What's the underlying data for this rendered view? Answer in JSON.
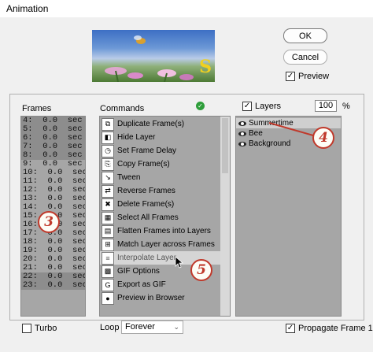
{
  "window": {
    "title": "Animation"
  },
  "buttons": {
    "ok": "OK",
    "cancel": "Cancel"
  },
  "preview": {
    "label": "Preview",
    "checked": true
  },
  "frames": {
    "label": "Frames",
    "rows": [
      "4:  0.0  sec",
      "5:  0.0  sec",
      "6:  0.0  sec",
      "7:  0.0  sec",
      "8:  0.0  sec",
      "9:  0.0  sec",
      "10:  0.0  sec",
      "11:  0.0  sec",
      "12:  0.0  sec",
      "13:  0.0  sec",
      "14:  0.0  sec",
      "15:  0.0  sec",
      "16:  0.0  sec",
      "17:  0.0  sec",
      "18:  0.0  sec",
      "19:  0.0  sec",
      "20:  0.0  sec",
      "21:  0.0  sec",
      "22:  0.0  sec",
      "23:  0.0  sec"
    ]
  },
  "commands": {
    "label": "Commands",
    "items": [
      {
        "label": "Duplicate Frame(s)",
        "icon": "duplicate-icon"
      },
      {
        "label": "Hide Layer",
        "icon": "hide-layer-icon"
      },
      {
        "label": "Set Frame Delay",
        "icon": "clock-icon"
      },
      {
        "label": "Copy Frame(s)",
        "icon": "copy-icon"
      },
      {
        "label": "Tween",
        "icon": "tween-icon"
      },
      {
        "label": "Reverse Frames",
        "icon": "reverse-icon"
      },
      {
        "label": "Delete Frame(s)",
        "icon": "delete-icon"
      },
      {
        "label": "Select All Frames",
        "icon": "select-all-icon"
      },
      {
        "label": "Flatten Frames into Layers",
        "icon": "flatten-icon"
      },
      {
        "label": "Match Layer across Frames",
        "icon": "match-layer-icon"
      },
      {
        "label": "Interpolate Layer",
        "icon": "interpolate-icon"
      },
      {
        "label": "GIF Options",
        "icon": "gif-options-icon"
      },
      {
        "label": "Export as GIF",
        "icon": "gif-export-icon"
      },
      {
        "label": "Preview in Browser",
        "icon": "browser-icon"
      }
    ]
  },
  "layers": {
    "label": "Layers",
    "opacity": "100",
    "opacity_unit": "%",
    "items": [
      {
        "label": "Summertime"
      },
      {
        "label": "Bee"
      },
      {
        "label": "Background"
      }
    ]
  },
  "bottom": {
    "turbo": "Turbo",
    "loop_label": "Loop",
    "loop_value": "Forever",
    "propagate": "Propagate Frame 1"
  },
  "annotations": [
    "3",
    "4",
    "5"
  ],
  "preview_text": "S"
}
